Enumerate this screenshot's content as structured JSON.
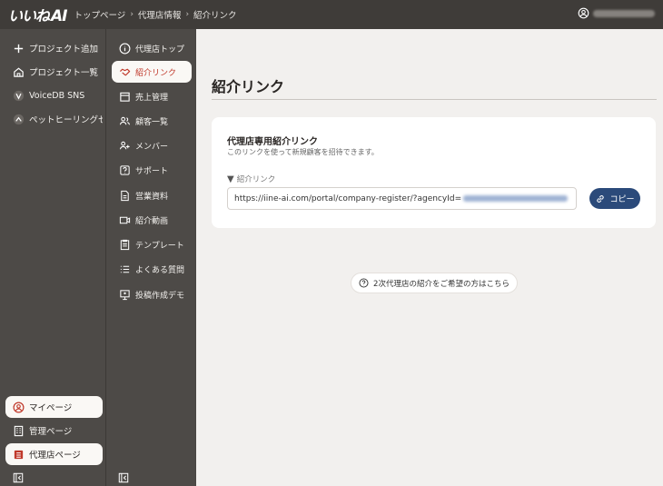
{
  "header": {
    "logo_text": "いいね",
    "logo_ai": "AI",
    "breadcrumbs": [
      "トップページ",
      "代理店情報",
      "紹介リンク"
    ],
    "account_icon": "account-circle-icon"
  },
  "sidebar_main": {
    "items": [
      {
        "label": "プロジェクト追加",
        "icon": "plus-icon"
      },
      {
        "label": "プロジェクト一覧",
        "icon": "home-icon"
      },
      {
        "label": "VoiceDB SNS",
        "icon": "v-circle-icon"
      },
      {
        "label": "ペットヒーリングセラ...",
        "icon": "chevron-circle-icon"
      }
    ],
    "bottom": [
      {
        "label": "マイページ",
        "icon": "account-circle-icon"
      },
      {
        "label": "管理ページ",
        "icon": "building-icon"
      },
      {
        "label": "代理店ページ",
        "icon": "agency-icon"
      }
    ]
  },
  "sidebar_sub": {
    "items": [
      {
        "label": "代理店トップ",
        "icon": "info-icon"
      },
      {
        "label": "紹介リンク",
        "icon": "handshake-icon"
      },
      {
        "label": "売上管理",
        "icon": "calendar-icon"
      },
      {
        "label": "顧客一覧",
        "icon": "users-icon"
      },
      {
        "label": "メンバー",
        "icon": "user-add-icon"
      },
      {
        "label": "サポート",
        "icon": "help-icon"
      },
      {
        "label": "営業資料",
        "icon": "document-icon"
      },
      {
        "label": "紹介動画",
        "icon": "video-icon"
      },
      {
        "label": "テンプレート",
        "icon": "template-icon"
      },
      {
        "label": "よくある質問",
        "icon": "list-icon"
      },
      {
        "label": "投稿作成デモ",
        "icon": "presentation-icon"
      }
    ]
  },
  "main": {
    "title": "紹介リンク",
    "card": {
      "title": "代理店専用紹介リンク",
      "description": "このリンクを使って新規顧客を招待できます。",
      "field_label": "紹介リンク",
      "url": "https://iine-ai.com/portal/company-register/?agencyId=",
      "copy_label": "コピー"
    },
    "secondary_link": "2次代理店の紹介をご希望の方はこちら"
  },
  "colors": {
    "sidebar": "#4d4a47",
    "topbar": "#3f3c39",
    "accent_red": "#c0392b",
    "copy_button": "#2b4a7a",
    "main_bg": "#f2f0ee"
  }
}
